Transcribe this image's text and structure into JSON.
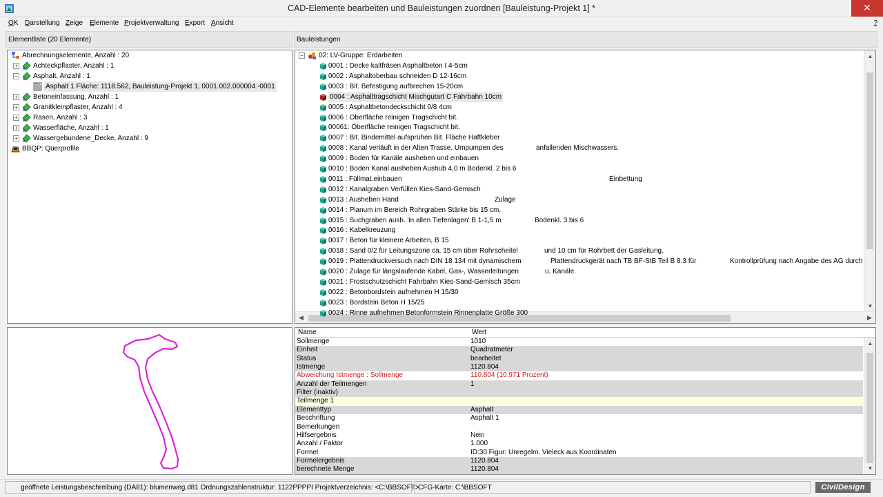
{
  "window": {
    "title": "CAD-Elemente bearbeiten und Bauleistungen zuordnen   [Bauleistung-Projekt 1] *",
    "close_glyph": "✕"
  },
  "menu": {
    "items": [
      {
        "u": "O",
        "rest": "K"
      },
      {
        "u": "D",
        "rest": "arstellung"
      },
      {
        "u": "Z",
        "rest": "eige"
      },
      {
        "u": "E",
        "rest": "lemente"
      },
      {
        "u": "P",
        "rest": "rojektverwaltung"
      },
      {
        "u": "E",
        "rest": "xport"
      },
      {
        "u": "A",
        "rest": "nsicht"
      }
    ],
    "help": "?"
  },
  "left_header": "Elementliste (20 Elemente)",
  "right_header": "Bauleistungen",
  "element_tree": [
    {
      "label": "Abrechnungselemente, Anzahl : 20",
      "icon": "network-icon",
      "exp": ""
    },
    {
      "label": "Achteckpflaster, Anzahl : 1",
      "icon": "element-green-icon",
      "exp": "+"
    },
    {
      "label": "Asphalt, Anzahl : 1",
      "icon": "element-green-icon",
      "exp": "−"
    },
    {
      "label": "Asphalt 1 Fläche: 1118.562, Bauleistung-Projekt 1, 0001.002.000004 -0001",
      "icon": "area-doc-icon",
      "exp": ""
    },
    {
      "label": "Betoneinfassung, Anzahl : 1",
      "icon": "element-green-icon",
      "exp": "+"
    },
    {
      "label": "Granitkleinpflaster, Anzahl : 4",
      "icon": "element-green-icon",
      "exp": "+"
    },
    {
      "label": "Rasen, Anzahl : 3",
      "icon": "element-green-icon",
      "exp": "+"
    },
    {
      "label": "Wasserfläche, Anzahl : 1",
      "icon": "element-green-icon",
      "exp": "+"
    },
    {
      "label": "Wassergebundene_Decke, Anzahl : 9",
      "icon": "element-green-icon",
      "exp": "+"
    },
    {
      "label": "BBQP: Querprofile",
      "icon": "profile-icon",
      "exp": ""
    }
  ],
  "lv_group": {
    "label": "02: LV-Gruppe: Erdarbeiten",
    "exp": "−"
  },
  "lv_items": [
    {
      "text": "0001 : Decke kaltfräsen Asphaltbeton t 4-5cm",
      "c2": "",
      "c3": ""
    },
    {
      "text": "0002 : Asphaltoberbau schneiden D 12-16cm",
      "c2": "",
      "c3": ""
    },
    {
      "text": "0003 : Bit. Befestigung aufbrechen 15-20cm",
      "c2": "",
      "c3": ""
    },
    {
      "text": "0004 : Asphalttragschicht Mischgutart C Fahrbahn 10cm",
      "c2": "",
      "c3": "",
      "selected": true
    },
    {
      "text": "0005 : Asphaltbetondeckschicht 0/8 4cm",
      "c2": "",
      "c3": ""
    },
    {
      "text": "0006 : Oberfläche reinigen Tragschicht bit.",
      "c2": "",
      "c3": ""
    },
    {
      "text": "00061: Oberfläche reinigen Tragschicht bit.",
      "c2": "",
      "c3": ""
    },
    {
      "text": "0007 : Bit. Bindemittel aufsprühen Bit. Fläche Haftkleber",
      "c2": "",
      "c3": ""
    },
    {
      "text": "0008 : Kanal verläuft in der Alten Trasse. Umpumpen des",
      "c2": "anfallenden Mischwassers.",
      "c3": ""
    },
    {
      "text": "0009 : Boden für Kanäle ausheben und einbauen",
      "c2": "",
      "c3": ""
    },
    {
      "text": "0010 : Boden Kanal ausheben Aushub 4,0 m Bodenkl. 2 bis 6",
      "c2": "",
      "c3": ""
    },
    {
      "text": "0011 : Füllmat.einbauen",
      "c2": "Einbettung",
      "c3": ""
    },
    {
      "text": "0012 : Kanalgraben Verfüllen Kies-Sand-Gemisch",
      "c2": "",
      "c3": ""
    },
    {
      "text": "0013 : Ausheben Hand",
      "c2": "Zulage",
      "c3": ""
    },
    {
      "text": "0014 : Planum im Bereich Rohrgraben Stärke bis 15 cm.",
      "c2": "",
      "c3": ""
    },
    {
      "text": "0015 : Suchgraben aush. 'in allen Tiefenlagen' B 1-1,5 m",
      "c2": "Bodenkl. 3 bis 6",
      "c3": ""
    },
    {
      "text": "0016 : Kabelkreuzung",
      "c2": "",
      "c3": ""
    },
    {
      "text": "0017 : Beton für kleinere Arbeiten, B 15",
      "c2": "",
      "c3": ""
    },
    {
      "text": "0018 : Sand 0/2 für Leitungszone ca. 15 cm über Rohrscheitel",
      "c2": "und 10 cm für Rohrbett der Gasleitung.",
      "c3": ""
    },
    {
      "text": "0019 : Plattendruckversuch nach DIN 18 134 mit dynamischem",
      "c2": "Plattendruckgerät nach TB BF-StB Teil B 8.3 für",
      "c3": "Kontrollprüfung nach Angabe des AG durchfül"
    },
    {
      "text": "0020 : Zulage für längslaufende Kabel, Gas-, Wasserleitungen",
      "c2": "u. Kanäle.",
      "c3": ""
    },
    {
      "text": "0021 : Frostschutzschicht Fahrbahn Kies-Sand-Gemisch 35cm",
      "c2": "",
      "c3": ""
    },
    {
      "text": "0022 : Betonbordstein aufnehmen H 15/30",
      "c2": "",
      "c3": ""
    },
    {
      "text": "0023 : Bordstein Beton H 15/25",
      "c2": "",
      "c3": ""
    },
    {
      "text": "0024 : Rinne aufnehmen Betonformstein Rinnenplatte Größe 300",
      "c2": "",
      "c3": ""
    }
  ],
  "lv_col_offsets": {
    "c2": "",
    "c3": ""
  },
  "props": {
    "col_name": "Name",
    "col_value": "Wert",
    "rows": [
      {
        "name": "Sollmenge",
        "value": "1010",
        "bg": "w"
      },
      {
        "name": "Einheit",
        "value": "Quadratmeter",
        "bg": "g"
      },
      {
        "name": "Status",
        "value": "bearbeitet",
        "bg": "g"
      },
      {
        "name": "Istmenge",
        "value": "1120.804",
        "bg": "g"
      },
      {
        "name": "Abweichung Istmenge : Sollmenge",
        "value": "110.804 (10.971 Prozent)",
        "bg": "w",
        "red": true
      },
      {
        "name": "Anzahl der Teilmengen",
        "value": "1",
        "bg": "g"
      },
      {
        "name": "Filter (inaktiv)",
        "value": "",
        "bg": "g"
      },
      {
        "name": "Teilmenge 1",
        "value": "",
        "bg": "y"
      },
      {
        "name": "Elementtyp",
        "value": "Asphalt",
        "bg": "g"
      },
      {
        "name": "Beschriftung",
        "value": "Asphalt 1",
        "bg": "w"
      },
      {
        "name": "Bemerkungen",
        "value": "",
        "bg": "w"
      },
      {
        "name": "Hilfsergebnis",
        "value": "Nein",
        "bg": "w"
      },
      {
        "name": "Anzahl / Faktor",
        "value": "1.000",
        "bg": "w"
      },
      {
        "name": "Formel",
        "value": " ID:30 Figur: Unregelm. Vieleck aus Koordinaten",
        "bg": "w"
      },
      {
        "name": "Formelergebnis",
        "value": "1120.804",
        "bg": "g"
      },
      {
        "name": "berechnete Menge",
        "value": "1120.804",
        "bg": "g"
      }
    ]
  },
  "status": {
    "left": "geöffnete Leistungsbeschreibung (DA81): blumenweg.d81 Ordnungszahlenstruktur: 1122PPPPI Projektverzeichnis: <C:\\BBSOFT>",
    "right": "CFG-Karte:   C:\\BBSOFT",
    "logo": "CivilDesign"
  },
  "colors": {
    "accent_green": "#3cb043",
    "cube_teal": "#1fa58c",
    "cube_red": "#b32020",
    "shape_magenta": "#e020e0",
    "close_red": "#c7362f"
  }
}
